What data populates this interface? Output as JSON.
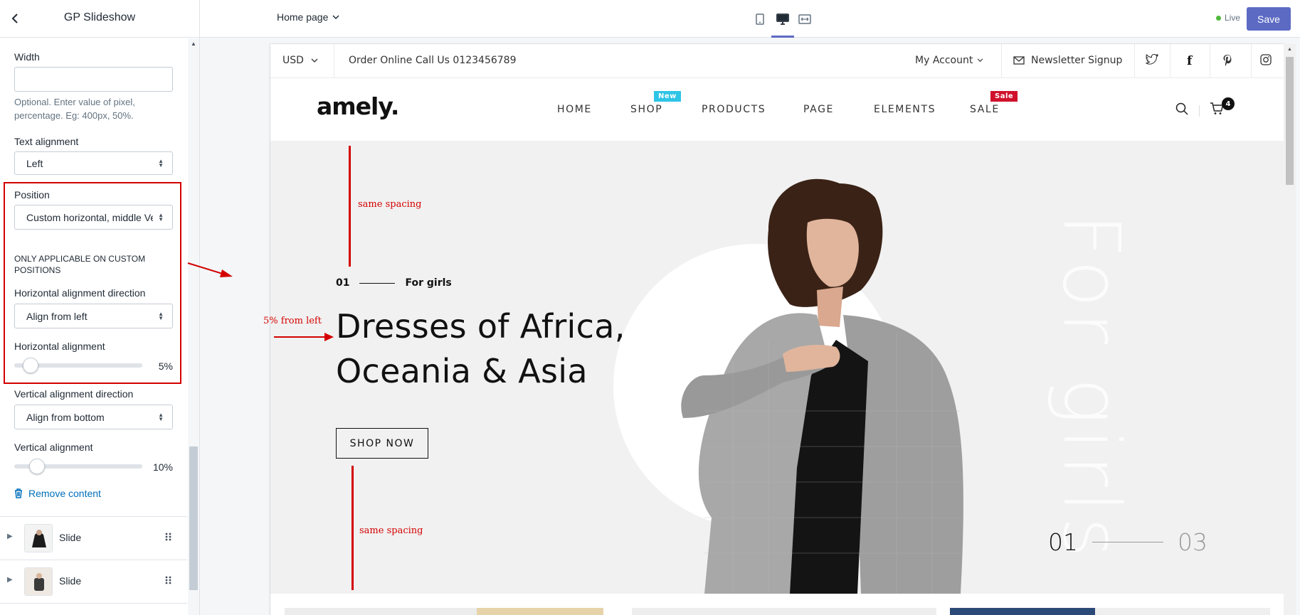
{
  "sidebar": {
    "title": "GP Slideshow",
    "width": {
      "label": "Width",
      "value": "",
      "help": "Optional. Enter value of pixel, percentage. Eg: 400px, 50%."
    },
    "text_alignment": {
      "label": "Text alignment",
      "value": "Left"
    },
    "position": {
      "label": "Position",
      "value": "Custom horizontal, middle Vertical"
    },
    "custom_note": "ONLY APPLICABLE ON CUSTOM POSITIONS",
    "h_dir": {
      "label": "Horizontal alignment direction",
      "value": "Align from left"
    },
    "h_align": {
      "label": "Horizontal alignment",
      "value_text": "5%",
      "value": 5
    },
    "v_dir": {
      "label": "Vertical alignment direction",
      "value": "Align from bottom"
    },
    "v_align": {
      "label": "Vertical alignment",
      "value_text": "10%",
      "value": 10
    },
    "remove": "Remove content",
    "slides": [
      {
        "label": "Slide"
      },
      {
        "label": "Slide"
      }
    ]
  },
  "topbar": {
    "page": "Home page",
    "status": "Live",
    "save": "Save",
    "devices": [
      "mobile-icon",
      "desktop-icon",
      "fullwidth-icon"
    ],
    "active_device": "desktop-icon",
    "accent": "#5c6ac4"
  },
  "store": {
    "currency": "USD",
    "phone": "Order Online Call Us 0123456789",
    "account": "My Account",
    "newsletter": "Newsletter Signup",
    "social": [
      "twitter-icon",
      "facebook-icon",
      "pinterest-icon",
      "instagram-icon"
    ],
    "logo": "amely.",
    "nav": [
      {
        "label": "HOME"
      },
      {
        "label": "SHOP",
        "tag": "New",
        "tag_color": "#2ec4e6"
      },
      {
        "label": "PRODUCTS"
      },
      {
        "label": "PAGE"
      },
      {
        "label": "ELEMENTS"
      },
      {
        "label": "SALE",
        "tag": "Sale",
        "tag_color": "#d0112b"
      }
    ],
    "cart_count": "4"
  },
  "hero": {
    "slide_no": "01",
    "subtitle": "For girls",
    "title": "Dresses of Africa,\nOceania & Asia",
    "button": "SHOP NOW",
    "vertical_text": "For girls",
    "pager_current": "01",
    "pager_total": "03"
  },
  "annotations": {
    "top_spacing": "same spacing",
    "left_note": "5% from left",
    "bottom_spacing": "same spacing",
    "color": "#d40000"
  }
}
